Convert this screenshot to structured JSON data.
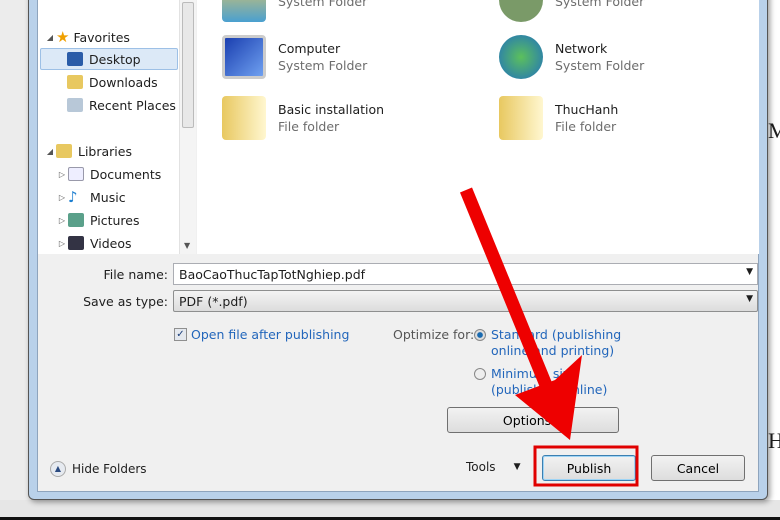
{
  "background": {
    "doc_letters": [
      "M",
      "H"
    ]
  },
  "sidebar": {
    "groups": [
      {
        "label": "Favorites",
        "items": [
          "Desktop",
          "Downloads",
          "Recent Places"
        ],
        "selected": "Desktop"
      },
      {
        "label": "Libraries",
        "items": [
          "Documents",
          "Music",
          "Pictures",
          "Videos"
        ]
      }
    ]
  },
  "content": {
    "items": [
      {
        "name": "",
        "type": "System Folder"
      },
      {
        "name": "",
        "type": "System Folder"
      },
      {
        "name": "Computer",
        "type": "System Folder"
      },
      {
        "name": "Network",
        "type": "System Folder"
      },
      {
        "name": "Basic installation",
        "type": "File folder"
      },
      {
        "name": "ThucHanh",
        "type": "File folder"
      }
    ]
  },
  "form": {
    "file_name_label": "File name:",
    "file_name_value": "BaoCaoThucTapTotNghiep.pdf",
    "save_type_label": "Save as type:",
    "save_type_value": "PDF (*.pdf)",
    "open_after_label": "Open file after publishing",
    "open_after_checked": true,
    "optimize_label": "Optimize for:",
    "opt_standard": "Standard (publishing online and printing)",
    "opt_minimum": "Minimum size (publishing online)",
    "opt_selected": "standard",
    "options_button": "Options..."
  },
  "footer": {
    "hide_folders": "Hide Folders",
    "tools": "Tools",
    "publish": "Publish",
    "cancel": "Cancel"
  },
  "annotation": {
    "arrow_color": "#ee0000",
    "highlight": "Publish"
  }
}
